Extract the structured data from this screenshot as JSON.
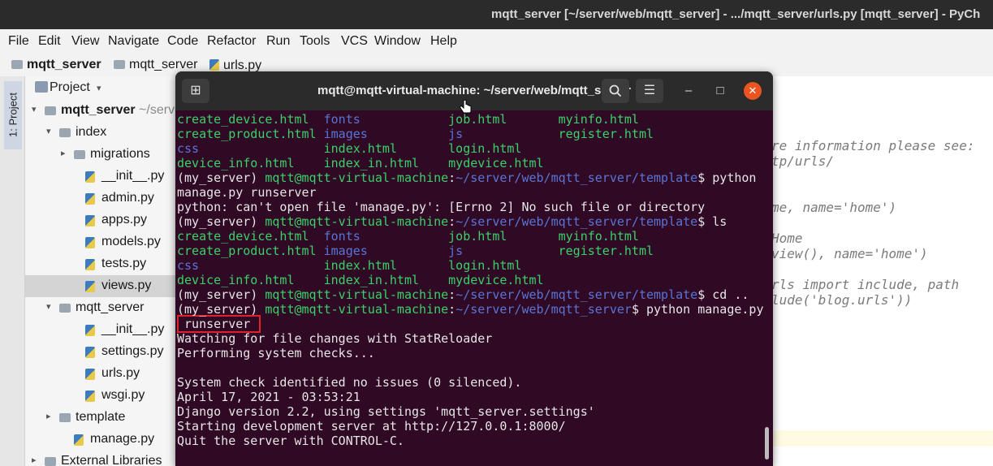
{
  "ide": {
    "title": "mqtt_server [~/server/web/mqtt_server] - .../mqtt_server/urls.py [mqtt_server] - PyCh",
    "menu": [
      "File",
      "Edit",
      "View",
      "Navigate",
      "Code",
      "Refactor",
      "Run",
      "Tools",
      "VCS",
      "Window",
      "Help"
    ],
    "breadcrumb": [
      "mqtt_server",
      "mqtt_server",
      "urls.py"
    ],
    "side_tab": "1: Project",
    "project_header": "Project",
    "tree": [
      {
        "label": "mqtt_server",
        "suffix": " ~/serve",
        "type": "folder",
        "indent": 0,
        "arrow": "▾"
      },
      {
        "label": "index",
        "type": "folder",
        "indent": 1,
        "arrow": "▾"
      },
      {
        "label": "migrations",
        "type": "folder",
        "indent": 2,
        "arrow": "▸"
      },
      {
        "label": "__init__.py",
        "type": "file",
        "indent": 3
      },
      {
        "label": "admin.py",
        "type": "file",
        "indent": 3
      },
      {
        "label": "apps.py",
        "type": "file",
        "indent": 3
      },
      {
        "label": "models.py",
        "type": "file",
        "indent": 3
      },
      {
        "label": "tests.py",
        "type": "file",
        "indent": 3
      },
      {
        "label": "views.py",
        "type": "file",
        "indent": 3,
        "selected": true
      },
      {
        "label": "mqtt_server",
        "type": "folder",
        "indent": 1,
        "arrow": "▾"
      },
      {
        "label": "__init__.py",
        "type": "file",
        "indent": 3
      },
      {
        "label": "settings.py",
        "type": "file",
        "indent": 3
      },
      {
        "label": "urls.py",
        "type": "file",
        "indent": 3
      },
      {
        "label": "wsgi.py",
        "type": "file",
        "indent": 3
      },
      {
        "label": "template",
        "type": "folder",
        "indent": 1,
        "arrow": "▸"
      },
      {
        "label": "manage.py",
        "type": "file",
        "indent": 2
      },
      {
        "label": "External Libraries",
        "type": "lib",
        "indent": 0,
        "arrow": "▸"
      }
    ],
    "editor_lines": [
      "re information please see:",
      "tp/urls/",
      "",
      "",
      "me, name='home')",
      "",
      "Home",
      "view(), name='home')",
      "",
      "rls import include, path",
      "lude('blog.urls'))"
    ]
  },
  "terminal": {
    "title": "mqtt@mqtt-virtual-machine: ~/server/web/mqtt_server",
    "buttons": {
      "new_tab": "⊞",
      "search": "🔍",
      "menu": "☰",
      "minimize": "–",
      "maximize": "□",
      "close": "✕"
    },
    "lines": [
      [
        {
          "t": "create_device.html  ",
          "c": "file"
        },
        {
          "t": "fonts            ",
          "c": "dir"
        },
        {
          "t": "job.html       ",
          "c": "file"
        },
        {
          "t": "myinfo.html",
          "c": "file"
        }
      ],
      [
        {
          "t": "create_product.html ",
          "c": "file"
        },
        {
          "t": "images           ",
          "c": "dir"
        },
        {
          "t": "js             ",
          "c": "dir"
        },
        {
          "t": "register.html",
          "c": "file"
        }
      ],
      [
        {
          "t": "css                 ",
          "c": "dir"
        },
        {
          "t": "index.html       ",
          "c": "file"
        },
        {
          "t": "login.html",
          "c": "file"
        }
      ],
      [
        {
          "t": "device_info.html    ",
          "c": "file"
        },
        {
          "t": "index_in.html    ",
          "c": "file"
        },
        {
          "t": "mydevice.html",
          "c": "file"
        }
      ],
      [
        {
          "t": "(my_server) ",
          "c": "plain"
        },
        {
          "t": "mqtt@mqtt-virtual-machine",
          "c": "user"
        },
        {
          "t": ":",
          "c": "plain"
        },
        {
          "t": "~/server/web/mqtt_server/template",
          "c": "path"
        },
        {
          "t": "$ python",
          "c": "plain"
        }
      ],
      [
        {
          "t": "manage.py runserver",
          "c": "plain"
        }
      ],
      [
        {
          "t": "python: can't open file 'manage.py': [Errno 2] No such file or directory",
          "c": "plain"
        }
      ],
      [
        {
          "t": "(my_server) ",
          "c": "plain"
        },
        {
          "t": "mqtt@mqtt-virtual-machine",
          "c": "user"
        },
        {
          "t": ":",
          "c": "plain"
        },
        {
          "t": "~/server/web/mqtt_server/template",
          "c": "path"
        },
        {
          "t": "$ ls",
          "c": "plain"
        }
      ],
      [
        {
          "t": "create_device.html  ",
          "c": "file"
        },
        {
          "t": "fonts            ",
          "c": "dir"
        },
        {
          "t": "job.html       ",
          "c": "file"
        },
        {
          "t": "myinfo.html",
          "c": "file"
        }
      ],
      [
        {
          "t": "create_product.html ",
          "c": "file"
        },
        {
          "t": "images           ",
          "c": "dir"
        },
        {
          "t": "js             ",
          "c": "dir"
        },
        {
          "t": "register.html",
          "c": "file"
        }
      ],
      [
        {
          "t": "css                 ",
          "c": "dir"
        },
        {
          "t": "index.html       ",
          "c": "file"
        },
        {
          "t": "login.html",
          "c": "file"
        }
      ],
      [
        {
          "t": "device_info.html    ",
          "c": "file"
        },
        {
          "t": "index_in.html    ",
          "c": "file"
        },
        {
          "t": "mydevice.html",
          "c": "file"
        }
      ],
      [
        {
          "t": "(my_server) ",
          "c": "plain"
        },
        {
          "t": "mqtt@mqtt-virtual-machine",
          "c": "user"
        },
        {
          "t": ":",
          "c": "plain"
        },
        {
          "t": "~/server/web/mqtt_server/template",
          "c": "path"
        },
        {
          "t": "$ cd ..",
          "c": "plain"
        }
      ],
      [
        {
          "t": "(my_server) ",
          "c": "plain"
        },
        {
          "t": "mqtt@mqtt-virtual-machine",
          "c": "user"
        },
        {
          "t": ":",
          "c": "plain"
        },
        {
          "t": "~/server/web/mqtt_server",
          "c": "path"
        },
        {
          "t": "$ python manage.py",
          "c": "plain"
        }
      ],
      [
        {
          "t": " runserver",
          "c": "plain"
        }
      ],
      [
        {
          "t": "Watching for file changes with StatReloader",
          "c": "plain"
        }
      ],
      [
        {
          "t": "Performing system checks...",
          "c": "plain"
        }
      ],
      [
        {
          "t": "",
          "c": "plain"
        }
      ],
      [
        {
          "t": "System check identified no issues (0 silenced).",
          "c": "plain"
        }
      ],
      [
        {
          "t": "April 17, 2021 - 03:53:21",
          "c": "plain"
        }
      ],
      [
        {
          "t": "Django version 2.2, using settings 'mqtt_server.settings'",
          "c": "plain"
        }
      ],
      [
        {
          "t": "Starting development server at http://127.0.0.1:8000/",
          "c": "plain"
        }
      ],
      [
        {
          "t": "Quit the server with CONTROL-C.",
          "c": "plain"
        }
      ]
    ]
  },
  "colors": {
    "terminal_bg": "#300a24",
    "user": "#3ad16b",
    "path": "#5a74d6",
    "highlight_box": "#e0202a"
  }
}
